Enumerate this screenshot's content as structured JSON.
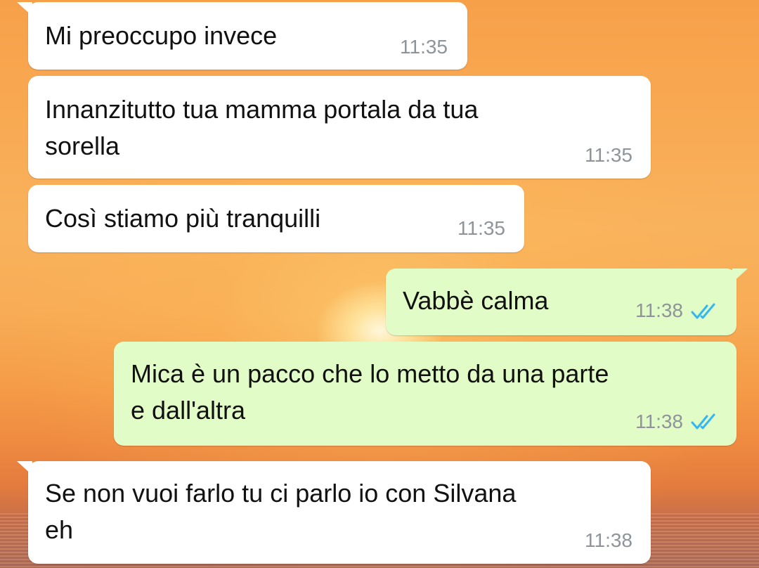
{
  "messages": [
    {
      "direction": "incoming",
      "text": "Mi preoccupo invece",
      "time": "11:35"
    },
    {
      "direction": "incoming",
      "text": "Innanzitutto tua mamma portala da tua\nsorella",
      "time": "11:35"
    },
    {
      "direction": "incoming",
      "text": "Così stiamo più tranquilli",
      "time": "11:35"
    },
    {
      "direction": "outgoing",
      "text": "Vabbè calma",
      "time": "11:38",
      "status": "read"
    },
    {
      "direction": "outgoing",
      "text": "Mica è un pacco che lo metto da una parte\ne dall'altra",
      "time": "11:38",
      "status": "read"
    },
    {
      "direction": "incoming",
      "text": "Se non vuoi farlo tu ci parlo io con Silvana\neh",
      "time": "11:38"
    }
  ],
  "colors": {
    "incoming_bubble": "#ffffff",
    "outgoing_bubble": "#e2fcc8",
    "timestamp": "#8e9499",
    "read_ticks": "#34b7f1"
  },
  "icons": {
    "read_status": "double-check-icon"
  }
}
